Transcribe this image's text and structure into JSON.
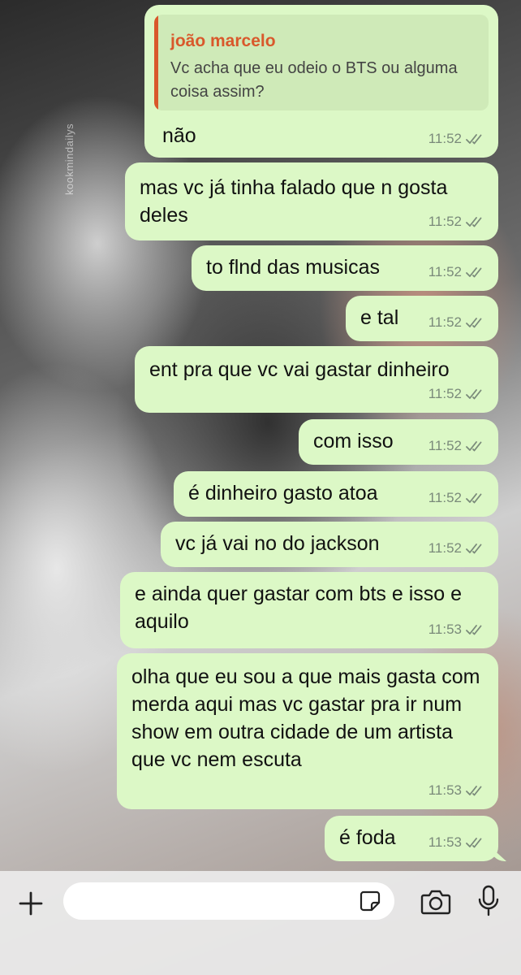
{
  "watermark": "kookmindailys",
  "messages": [
    {
      "quote_author": "joão marcelo",
      "quote_text": "Vc acha que eu odeio o BTS ou alguma coisa assim?",
      "text": "não",
      "time": "11:52"
    },
    {
      "text": "mas vc já tinha falado que n gosta deles",
      "time": "11:52"
    },
    {
      "text": "to flnd das musicas",
      "time": "11:52"
    },
    {
      "text": "e tal",
      "time": "11:52"
    },
    {
      "text": "ent pra que vc vai gastar dinheiro",
      "time": "11:52"
    },
    {
      "text": "com isso",
      "time": "11:52"
    },
    {
      "text": "é dinheiro gasto atoa",
      "time": "11:52"
    },
    {
      "text": "vc já vai no do jackson",
      "time": "11:52"
    },
    {
      "text": "e ainda quer gastar com bts e isso e aquilo",
      "time": "11:53"
    },
    {
      "text": "olha que eu sou a que mais gasta com merda aqui mas vc gastar pra ir num show em outra cidade de um artista que vc nem escuta",
      "time": "11:53"
    },
    {
      "text": "é foda",
      "time": "11:53"
    }
  ],
  "composer": {
    "placeholder": "",
    "icons": [
      "plus-icon",
      "sticker-icon",
      "camera-icon",
      "microphone-icon"
    ]
  },
  "colors": {
    "bubble": "#dcf8c6",
    "quote_accent": "#d9582b",
    "tick": "#7a8a7a"
  }
}
